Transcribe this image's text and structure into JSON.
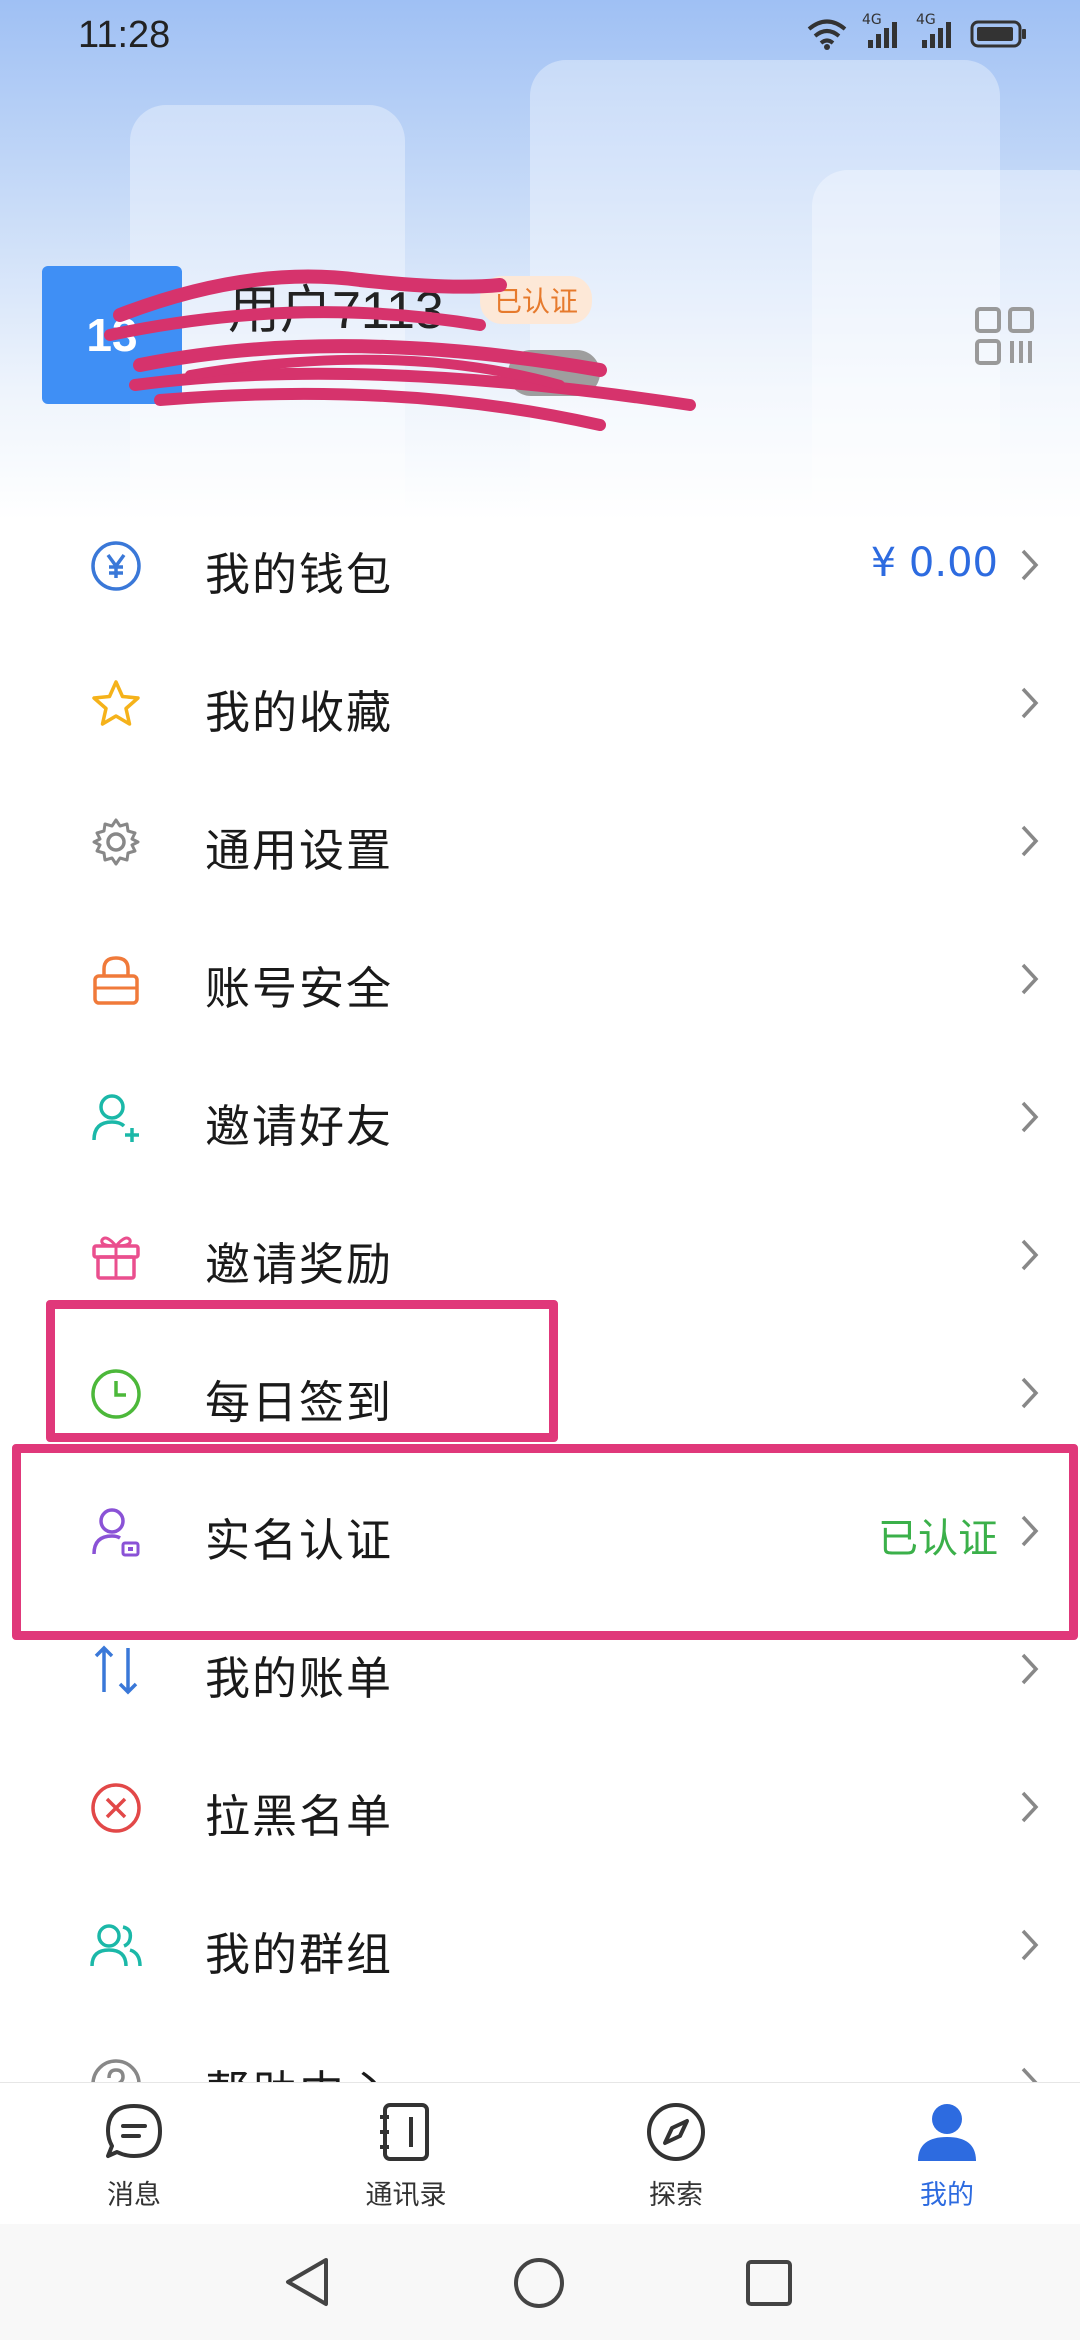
{
  "status_bar": {
    "time": "11:28",
    "net1": "4G",
    "net2": "4G"
  },
  "profile": {
    "avatar_text": "13",
    "name": "用户7113",
    "verified_badge": "已认证"
  },
  "menu": [
    {
      "label": "我的钱包",
      "value": "¥ 0.00",
      "icon": "wallet-icon",
      "color": "#3a78d8"
    },
    {
      "label": "我的收藏",
      "value": "",
      "icon": "star-icon",
      "color": "#f5b21a"
    },
    {
      "label": "通用设置",
      "value": "",
      "icon": "gear-icon",
      "color": "#888888"
    },
    {
      "label": "账号安全",
      "value": "",
      "icon": "lock-icon",
      "color": "#f07a3a"
    },
    {
      "label": "邀请好友",
      "value": "",
      "icon": "add-friend-icon",
      "color": "#1bb8a8"
    },
    {
      "label": "邀请奖励",
      "value": "",
      "icon": "gift-icon",
      "color": "#ea4f8e"
    },
    {
      "label": "每日签到",
      "value": "",
      "icon": "clock-icon",
      "color": "#4cb83a"
    },
    {
      "label": "实名认证",
      "value": "已认证",
      "icon": "id-user-icon",
      "color": "#8a52d6"
    },
    {
      "label": "我的账单",
      "value": "",
      "icon": "bill-icon",
      "color": "#3a78d8"
    },
    {
      "label": "拉黑名单",
      "value": "",
      "icon": "block-icon",
      "color": "#e24848"
    },
    {
      "label": "我的群组",
      "value": "",
      "icon": "group-icon",
      "color": "#1bb8a8"
    },
    {
      "label": "帮助中心",
      "value": "",
      "icon": "help-icon",
      "color": "#888888"
    }
  ],
  "tabs": [
    {
      "label": "消息",
      "icon": "message-icon"
    },
    {
      "label": "通讯录",
      "icon": "contacts-icon"
    },
    {
      "label": "探索",
      "icon": "compass-icon"
    },
    {
      "label": "我的",
      "icon": "profile-icon"
    }
  ],
  "colors": {
    "accent": "#2d6be0",
    "verified_green": "#3bb04a",
    "highlight": "#e0387a"
  }
}
